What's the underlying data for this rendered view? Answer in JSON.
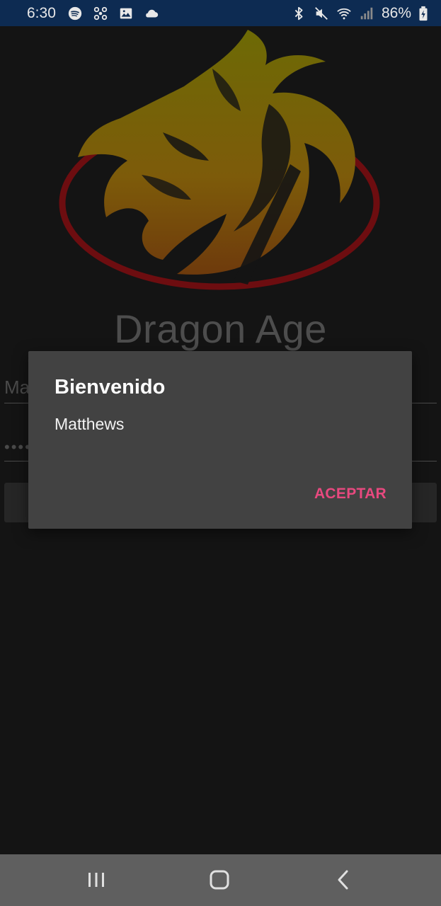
{
  "status_bar": {
    "time": "6:30",
    "battery_percent": "86%",
    "left_icons": [
      "spotify-icon",
      "fan-icon",
      "image-icon",
      "cloud-icon"
    ],
    "right_icons": [
      "bluetooth-icon",
      "mute-icon",
      "wifi-icon",
      "signal-icon",
      "battery-icon"
    ]
  },
  "app": {
    "title": "Dragon Age",
    "logo": "dragon-logo",
    "username_value": "Ma",
    "password_value": "••••"
  },
  "dialog": {
    "title": "Bienvenido",
    "message": "Matthews",
    "button": "ACEPTAR"
  },
  "navigation_bar": {
    "buttons": [
      "recents-icon",
      "home-icon",
      "back-icon"
    ]
  },
  "colors": {
    "status_bar": "#0d2b52",
    "background": "#141414",
    "dialog": "#424242",
    "accent": "#e8497f",
    "nav_bar": "#5f5f5f"
  }
}
